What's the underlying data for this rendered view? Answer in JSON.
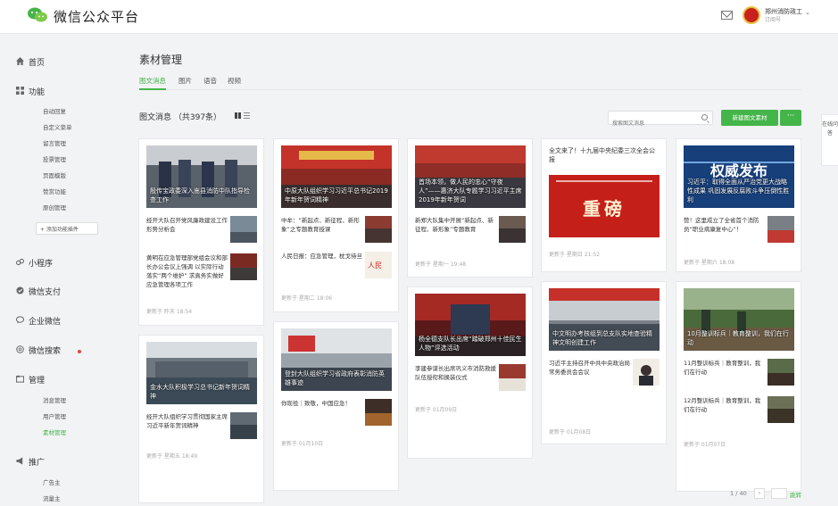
{
  "header": {
    "brand": "微信公众平台",
    "account_name": "郑州消防政工",
    "account_sub": "订阅号",
    "logo_icon": "wechat-logo-icon",
    "mail_icon": "mail-icon"
  },
  "sidebar": {
    "home": "首页",
    "features": "功能",
    "feature_items": [
      "自动回复",
      "自定义菜单",
      "留言管理",
      "投票管理",
      "页面模版",
      "赞赏功能",
      "原创管理"
    ],
    "add_feature": "+ 添加功能插件",
    "mini_program": "小程序",
    "wechat_pay": "微信支付",
    "enterprise_wechat": "企业微信",
    "wechat_search": "微信搜索",
    "manage": "管理",
    "manage_items": [
      "消息管理",
      "用户管理",
      "素材管理"
    ],
    "promote": "推广",
    "promote_items": [
      "广告主",
      "流量主"
    ]
  },
  "main": {
    "title": "素材管理",
    "tabs": [
      "图文消息",
      "图片",
      "语音",
      "视频"
    ],
    "count_label": "图文消息 （共397条）",
    "search_placeholder": "搜索图文消息",
    "new_button": "新建图文素材",
    "more_button": "···",
    "pager": "1 / 40",
    "pager_next": "›",
    "jump": "跳转"
  },
  "cards": {
    "c1": {
      "cover_caption": "殷传宝政委深入嵩县消防中队指导检查工作",
      "items": [
        {
          "title": "经开大队召开党风廉政建设工作形势分析会"
        },
        {
          "title": "黄明在应急管理部党组会议和部长办公会议上强调 以实际行动落实“两个维护” 求真务实做好应急管理各项工作"
        }
      ],
      "updated": "更新于 昨天 18:54"
    },
    "c2": {
      "cover_caption": "中原大队组织学习习近平总书记2019年新年贺词精神",
      "items": [
        {
          "title": "中牟：“新起点、新征程、新形象”之专题教育授课"
        },
        {
          "title": "人民日报：应急管理，枕戈待旦"
        }
      ],
      "updated": "更新于 星期二 18:06"
    },
    "c3": {
      "cover_caption": "首场本领，做人民的忠心“守夜人”——惠济大队专题学习习近平主席2019年新年贺词",
      "items": [
        {
          "title": "新郑大队集中开展“新起点、新征程、新形象”专题教育"
        }
      ],
      "updated": "更新于 星期一 19:48"
    },
    "c4": {
      "title": "全文来了！十九届中央纪委三次全会公报",
      "cover_text": "重磅",
      "updated": "更新于 星期日 21:52"
    },
    "c5": {
      "cover_caption": "习近平：取得全面从严治党更大战略性成果 巩固发展反腐败斗争压倒性胜利",
      "items": [
        {
          "title": "赞！这里成立了全省首个消防员“职业病康复中心”！"
        }
      ],
      "updated": "更新于 星期六 18:08"
    },
    "c6": {
      "cover_caption": "金水大队积极学习总书记新年贺词精神",
      "items": [
        {
          "title": "经开大队组织学习贯彻国家主席习近平新年贺词精神"
        }
      ],
      "updated": "更新于 星期五 18:49"
    },
    "c7": {
      "cover_caption": "登封大队组织学习省政府表彰消防英雄事迹",
      "items": [
        {
          "title": "你现役｜致敬，中国应急！"
        }
      ],
      "updated": "更新于 01月10日"
    },
    "c8": {
      "cover_caption": "杨全德支队长出席“踏破郑州十佳民生人物”评选活动",
      "items": [
        {
          "title": "李建参谋长出席巩义市消防救援队伍授衔和换装仪式"
        }
      ],
      "updated": "更新于 01月09日"
    },
    "c9": {
      "cover_caption": "中文明办考核组到总支队实地查验精神文明创建工作",
      "items": [
        {
          "title": "习近平主持召开中共中央政治局常务委员会会议"
        }
      ],
      "updated": "更新于 01月08日"
    },
    "c10": {
      "cover_caption": "10月整训标兵｜教育整训，我们在行动",
      "items": [
        {
          "title": "11月整训标兵｜教育整训，我们在行动"
        },
        {
          "title": "12月整训标兵｜教育整训，我们在行动"
        }
      ],
      "updated": "更新于 01月07日"
    }
  },
  "float_tab": "在线问答",
  "colors": {
    "accent": "#44b549",
    "headline_red": "#c8211e"
  }
}
